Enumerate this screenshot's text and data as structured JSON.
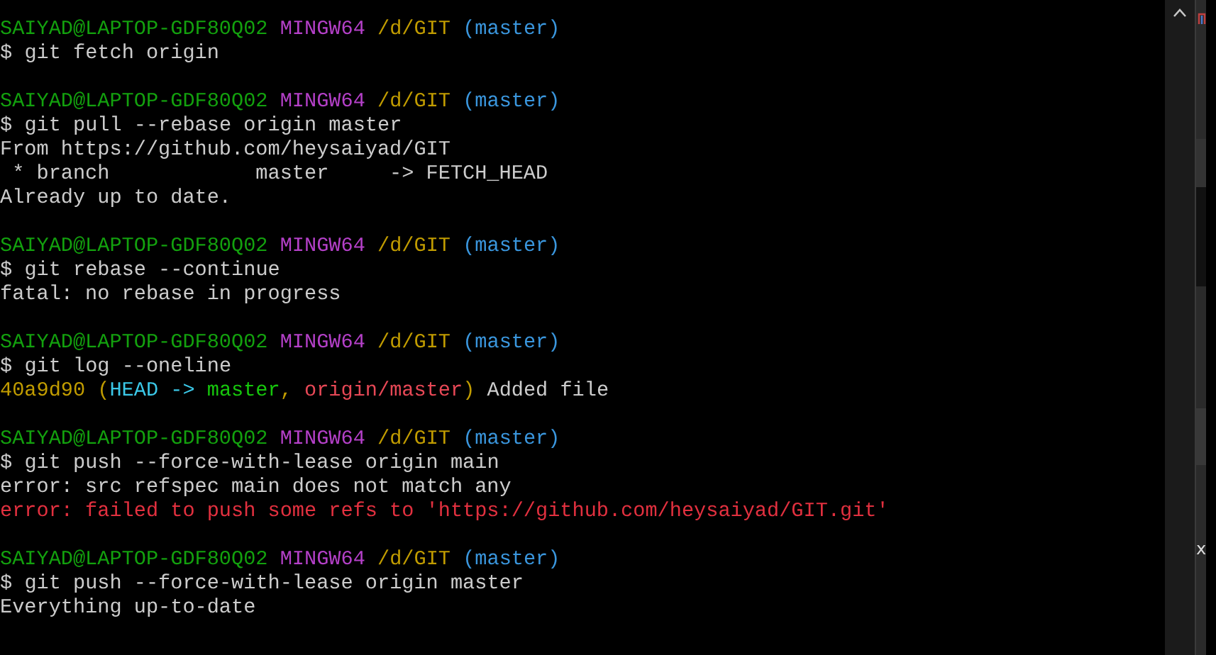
{
  "terminal": {
    "lines": [
      {
        "kind": "prompt",
        "user": "SAIYAD@LAPTOP-GDF80Q02",
        "system": "MINGW64",
        "path": "/d/GIT",
        "branch": "(master)"
      },
      {
        "kind": "command",
        "symbol": "$",
        "text": "git fetch origin"
      },
      {
        "kind": "blank"
      },
      {
        "kind": "prompt",
        "user": "SAIYAD@LAPTOP-GDF80Q02",
        "system": "MINGW64",
        "path": "/d/GIT",
        "branch": "(master)"
      },
      {
        "kind": "command",
        "symbol": "$",
        "text": "git pull --rebase origin master"
      },
      {
        "kind": "output",
        "text": "From https://github.com/heysaiyad/GIT"
      },
      {
        "kind": "output",
        "text": " * branch            master     -> FETCH_HEAD"
      },
      {
        "kind": "output",
        "text": "Already up to date."
      },
      {
        "kind": "blank"
      },
      {
        "kind": "prompt",
        "user": "SAIYAD@LAPTOP-GDF80Q02",
        "system": "MINGW64",
        "path": "/d/GIT",
        "branch": "(master)"
      },
      {
        "kind": "command",
        "symbol": "$",
        "text": "git rebase --continue"
      },
      {
        "kind": "output",
        "text": "fatal: no rebase in progress"
      },
      {
        "kind": "blank"
      },
      {
        "kind": "prompt",
        "user": "SAIYAD@LAPTOP-GDF80Q02",
        "system": "MINGW64",
        "path": "/d/GIT",
        "branch": "(master)"
      },
      {
        "kind": "command",
        "symbol": "$",
        "text": "git log --oneline"
      },
      {
        "kind": "log",
        "segments": [
          {
            "text": "40a9d90 (",
            "color": "#c19c00"
          },
          {
            "text": "HEAD -> ",
            "color": "#3bc8e8"
          },
          {
            "text": "master",
            "color": "#16c60c"
          },
          {
            "text": ", ",
            "color": "#c19c00"
          },
          {
            "text": "origin/master",
            "color": "#e74856"
          },
          {
            "text": ")",
            "color": "#c19c00"
          },
          {
            "text": " Added file",
            "color": "#cccccc"
          }
        ]
      },
      {
        "kind": "blank"
      },
      {
        "kind": "prompt",
        "user": "SAIYAD@LAPTOP-GDF80Q02",
        "system": "MINGW64",
        "path": "/d/GIT",
        "branch": "(master)"
      },
      {
        "kind": "command",
        "symbol": "$",
        "text": "git push --force-with-lease origin main"
      },
      {
        "kind": "output",
        "text": "error: src refspec main does not match any"
      },
      {
        "kind": "error",
        "text": "error: failed to push some refs to 'https://github.com/heysaiyad/GIT.git'"
      },
      {
        "kind": "blank"
      },
      {
        "kind": "prompt",
        "user": "SAIYAD@LAPTOP-GDF80Q02",
        "system": "MINGW64",
        "path": "/d/GIT",
        "branch": "(master)"
      },
      {
        "kind": "command",
        "symbol": "$",
        "text": "git push --force-with-lease origin master"
      },
      {
        "kind": "output",
        "text": "Everything up-to-date"
      }
    ]
  },
  "side_window": {
    "text": "x"
  }
}
